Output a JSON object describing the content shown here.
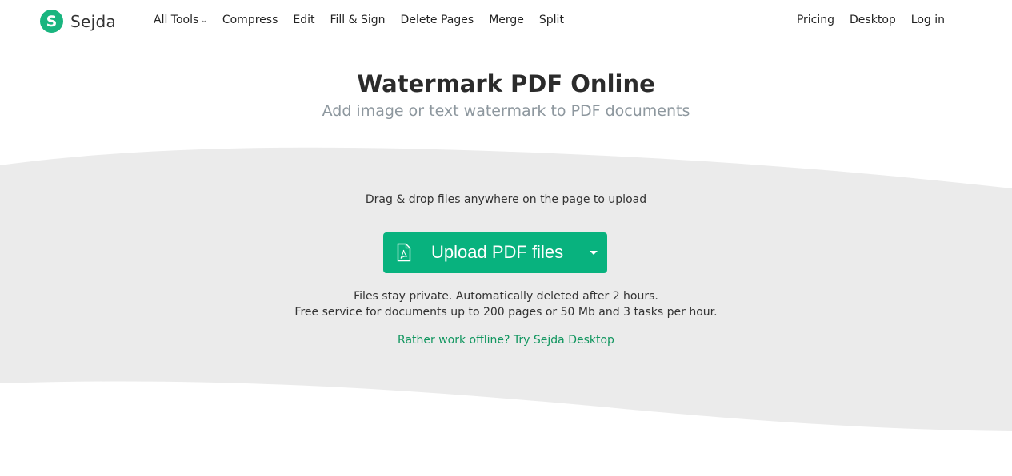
{
  "brand": {
    "logo_letter": "S",
    "name": "Sejda",
    "accent_color": "#08b27e"
  },
  "nav": {
    "left": [
      {
        "label": "All Tools",
        "has_dropdown": true
      },
      {
        "label": "Compress"
      },
      {
        "label": "Edit"
      },
      {
        "label": "Fill & Sign"
      },
      {
        "label": "Delete Pages"
      },
      {
        "label": "Merge"
      },
      {
        "label": "Split"
      }
    ],
    "right": [
      {
        "label": "Pricing"
      },
      {
        "label": "Desktop"
      },
      {
        "label": "Log in"
      }
    ],
    "dropdown_icon": "chevron-down-icon"
  },
  "hero": {
    "title": "Watermark PDF Online",
    "subtitle": "Add image or text watermark to PDF documents"
  },
  "upload": {
    "drop_hint": "Drag & drop files anywhere on the page to upload",
    "button_label": "Upload PDF files",
    "button_icon": "pdf-file-icon",
    "dropdown_icon": "caret-down-icon",
    "privacy_note": "Files stay private. Automatically deleted after 2 hours.",
    "limits_note": "Free service for documents up to 200 pages or 50 Mb and 3 tasks per hour.",
    "offline_link": "Rather work offline? Try Sejda Desktop"
  }
}
